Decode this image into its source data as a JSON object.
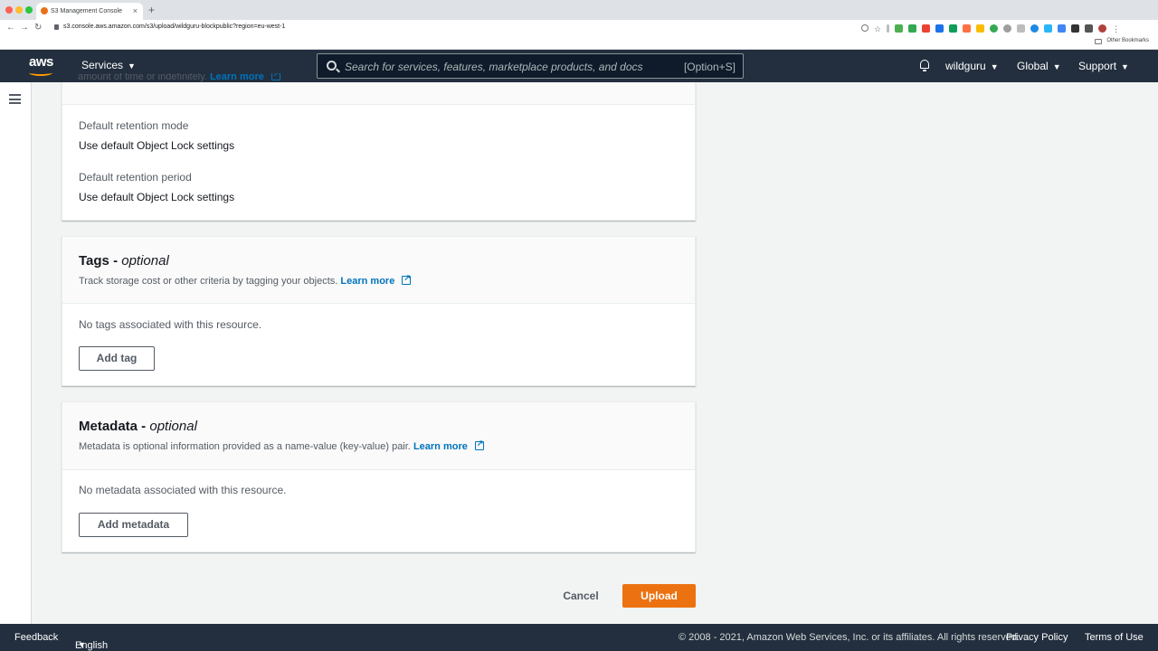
{
  "browser": {
    "tab_title": "S3 Management Console",
    "tab_close": "×",
    "new_tab": "+",
    "url": "s3.console.aws.amazon.com/s3/upload/wildguru-blockpublic?region=eu-west-1",
    "bookmarks_label": "Other Bookmarks",
    "nav": {
      "back": "←",
      "forward": "→",
      "reload": "↻"
    }
  },
  "aws_nav": {
    "logo_text": "aws",
    "services_label": "Services",
    "caret": "▼",
    "search_placeholder": "Search for services, features, marketplace products, and docs",
    "search_shortcut": "[Option+S]",
    "account": "wildguru",
    "region": "Global",
    "support": "Support"
  },
  "object_lock": {
    "truncated_text": "amount of time or indefinitely.",
    "truncated_link": "Learn more",
    "retention_mode_label": "Default retention mode",
    "retention_mode_value": "Use default Object Lock settings",
    "retention_period_label": "Default retention period",
    "retention_period_value": "Use default Object Lock settings"
  },
  "tags": {
    "title": "Tags - ",
    "title_suffix": "optional",
    "description": "Track storage cost or other criteria by tagging your objects.",
    "learn_more": "Learn more",
    "empty_text": "No tags associated with this resource.",
    "add_button": "Add tag"
  },
  "metadata": {
    "title": "Metadata - ",
    "title_suffix": "optional",
    "description": "Metadata is optional information provided as a name-value (key-value) pair.",
    "learn_more": "Learn more",
    "empty_text": "No metadata associated with this resource.",
    "add_button": "Add metadata"
  },
  "actions": {
    "cancel": "Cancel",
    "upload": "Upload"
  },
  "footer": {
    "feedback": "Feedback",
    "language": "English (US)",
    "copyright": "© 2008 - 2021, Amazon Web Services, Inc. or its affiliates. All rights reserved.",
    "privacy": "Privacy Policy",
    "terms": "Terms of Use"
  },
  "colors": {
    "nav_bg": "#232f3e",
    "accent_orange": "#ec7211",
    "link_blue": "#0073bb",
    "page_bg": "#f2f3f3"
  }
}
